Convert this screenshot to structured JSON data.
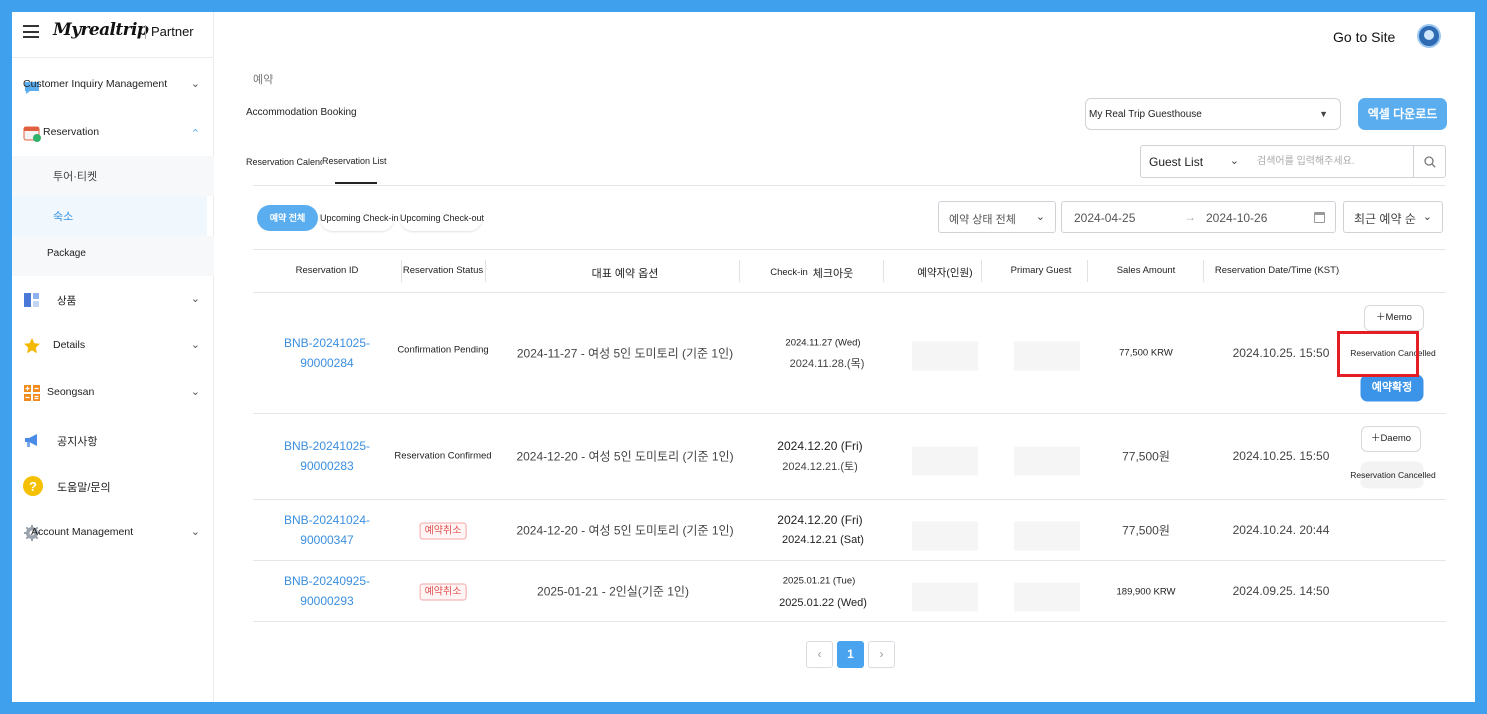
{
  "sidebar": {
    "logo": "Myrealtrip",
    "partner": "Partner",
    "items": [
      {
        "label": "Customer Inquiry Management",
        "icon": "chat-bubble-icon"
      },
      {
        "label": "Reservation",
        "icon": "calendar-check-icon"
      },
      {
        "label": "투어·티켓"
      },
      {
        "label": "숙소"
      },
      {
        "label": "Package"
      },
      {
        "label": "상품",
        "icon": "grid-icon"
      },
      {
        "label": "Details",
        "icon": "star-icon"
      },
      {
        "label": "Seongsan",
        "icon": "apps-icon"
      },
      {
        "label": "공지사항",
        "icon": "megaphone-icon"
      },
      {
        "label": "도움말/문의",
        "icon": "help-icon"
      },
      {
        "label": "Account Management",
        "icon": "gear-icon"
      }
    ]
  },
  "header": {
    "go_to_site": "Go to Site",
    "breadcrumb": "예약",
    "title": "Accommodation Booking",
    "property": "My Real Trip Guesthouse",
    "excel_button": "엑셀 다운로드"
  },
  "tabs": {
    "calendar": "Reservation Calendar",
    "list": "Reservation List"
  },
  "search": {
    "type": "Guest List",
    "placeholder": "검색어를 입력해주세요."
  },
  "filters": {
    "pills": [
      "예약 전체",
      "Upcoming Check-in",
      "Upcoming Check-out"
    ],
    "status": "예약 상태 전체",
    "date_from": "2024-04-25",
    "date_to": "2024-10-26",
    "sort": "최근 예약 순"
  },
  "table": {
    "headers": [
      "Reservation ID",
      "Reservation Status",
      "대표 예약 옵션",
      "Check-in",
      "체크아웃",
      "예약자(인원)",
      "Primary Guest",
      "Sales Amount",
      "Reservation Date/Time (KST)"
    ],
    "rows": [
      {
        "id_line1": "BNB-20241025-",
        "id_line2": "90000284",
        "status": "Confirmation Pending",
        "option": "2024-11-27 - 여성 5인 도미토리 (기준 1인)",
        "checkin": "2024.11.27 (Wed)",
        "checkout": "2024.11.28.(목)",
        "amount": "77,500 KRW",
        "datetime": "2024.10.25. 15:50",
        "memo": "Memo",
        "cancel": "Reservation Cancelled",
        "confirm": "예약확정"
      },
      {
        "id_line1": "BNB-20241025-",
        "id_line2": "90000283",
        "status": "Reservation Confirmed",
        "option": "2024-12-20 - 여성 5인 도미토리 (기준 1인)",
        "checkin": "2024.12.20 (Fri)",
        "checkout": "2024.12.21.(토)",
        "amount": "77,500원",
        "datetime": "2024.10.25. 15:50",
        "memo": "Daemo",
        "cancel": "Reservation Cancelled"
      },
      {
        "id_line1": "BNB-20241024-",
        "id_line2": "90000347",
        "status": "예약취소",
        "option": "2024-12-20 - 여성 5인 도미토리 (기준 1인)",
        "checkin": "2024.12.20 (Fri)",
        "checkout": "2024.12.21 (Sat)",
        "amount": "77,500원",
        "datetime": "2024.10.24. 20:44"
      },
      {
        "id_line1": "BNB-20240925-",
        "id_line2": "90000293",
        "status": "예약취소",
        "option": "2025-01-21 - 2인실(기준 1인)",
        "checkin": "2025.01.21 (Tue)",
        "checkout": "2025.01.22 (Wed)",
        "amount": "189,900 KRW",
        "datetime": "2024.09.25. 14:50"
      }
    ]
  },
  "pagination": {
    "current": "1",
    "prev": "‹",
    "next": "›"
  },
  "colors": {
    "accent": "#5aaef0",
    "link": "#3b8fe0",
    "highlight": "#e31e24",
    "cancel_badge": "#e45454"
  }
}
